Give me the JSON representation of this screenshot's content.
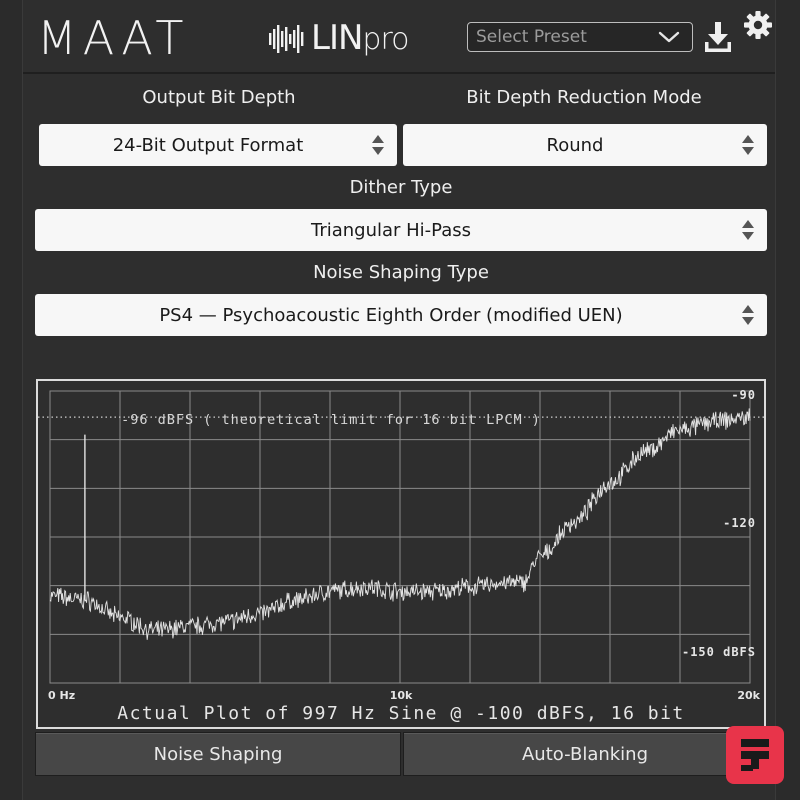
{
  "header": {
    "brand": "MAAT",
    "product_prefix": "LIN",
    "product_suffix": "pro",
    "preset_placeholder": "Select Preset",
    "icons": [
      "chevron-down-icon",
      "download-icon",
      "gear-icon"
    ]
  },
  "fields": {
    "output_bit_depth": {
      "label": "Output Bit Depth",
      "value": "24-Bit Output Format"
    },
    "reduction_mode": {
      "label": "Bit Depth Reduction Mode",
      "value": "Round"
    },
    "dither_type": {
      "label": "Dither Type",
      "value": "Triangular Hi-Pass"
    },
    "noise_shaping_type": {
      "label": "Noise Shaping Type",
      "value": "PS4 — Psychoacoustic Eighth Order (modified UEN)"
    }
  },
  "plot": {
    "reference_label": "-96 dBFS ( theoretical limit for 16 bit LPCM )",
    "caption": "Actual Plot of 997 Hz Sine @ -100 dBFS, 16 bit",
    "x_ticks": [
      "0 Hz",
      "10k",
      "20k"
    ],
    "y_ticks": [
      "-90",
      "-120",
      "-150 dBFS"
    ]
  },
  "buttons": {
    "noise_shaping": "Noise Shaping",
    "auto_blanking": "Auto-Blanking"
  },
  "chart_data": {
    "type": "line",
    "x_unit": "Hz",
    "y_unit": "dBFS",
    "xlim": [
      0,
      20000
    ],
    "ylim": [
      -157,
      -90
    ],
    "reference_line": -96,
    "x_ticks": [
      0,
      10000,
      20000
    ],
    "y_ticks": [
      -90,
      -120,
      -150
    ],
    "grid": true,
    "peak": {
      "x": 997,
      "y": -100
    },
    "series": [
      {
        "x": [
          0,
          1000,
          2000,
          3000,
          4000,
          5000,
          6000,
          7000,
          8000,
          9000,
          10000,
          11000,
          12000,
          13000,
          13500,
          14000,
          15000,
          16000,
          17000,
          18000,
          19000,
          20000
        ],
        "values": [
          -137,
          -138,
          -142,
          -145,
          -144,
          -143,
          -141,
          -138,
          -136,
          -135,
          -136,
          -136,
          -135,
          -134,
          -134,
          -128,
          -120,
          -111,
          -104,
          -99,
          -97,
          -96
        ]
      }
    ],
    "colors": {
      "trace": "#e4e4e4",
      "grid": "#8a8a8a",
      "background": "#2e2e2e"
    }
  },
  "colors": {
    "panel": "#2e2e2e",
    "select_bg": "#f7f7f7",
    "button_bg": "#474747",
    "accent_badge": "#e8344a"
  }
}
